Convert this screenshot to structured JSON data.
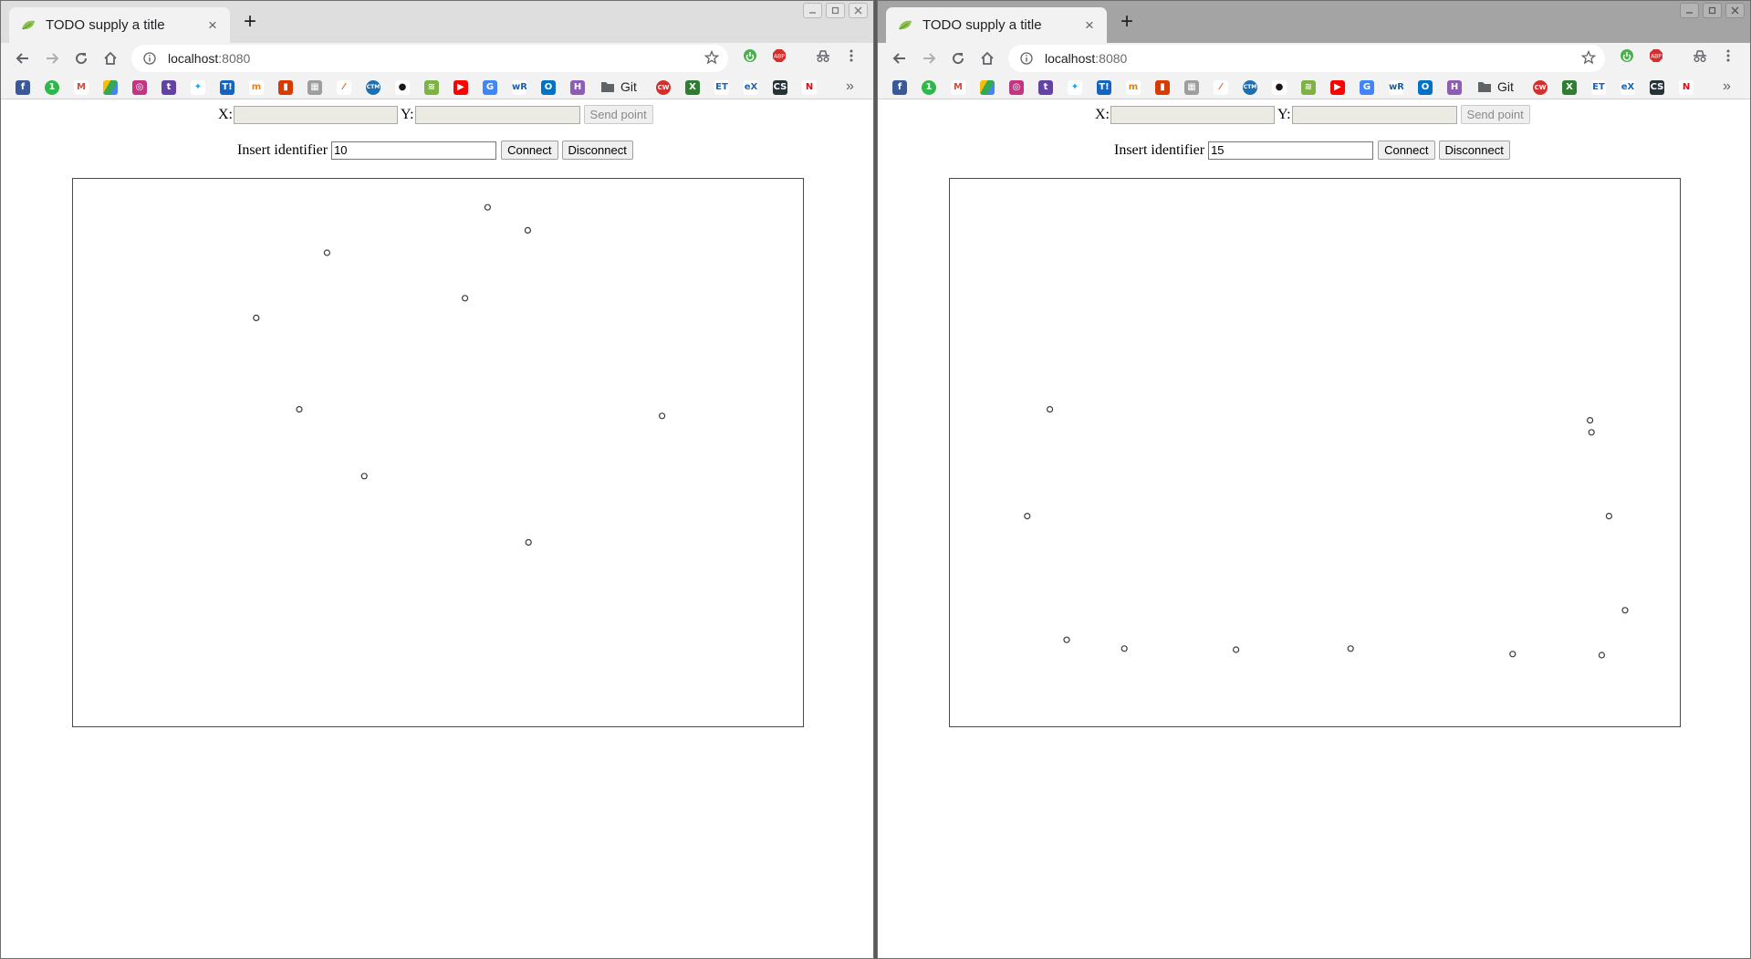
{
  "windows": [
    {
      "tab": {
        "title": "TODO supply a title"
      },
      "address": {
        "host": "localhost",
        "port": ":8080"
      },
      "bookmarks": {
        "folder_label": "Git"
      },
      "form": {
        "x_label": "X:",
        "y_label": "Y:",
        "send_label": "Send point",
        "identifier_label": "Insert identifier",
        "identifier_value": "10",
        "connect_label": "Connect",
        "disconnect_label": "Disconnect"
      },
      "points": [
        [
          0.568,
          0.052
        ],
        [
          0.623,
          0.094
        ],
        [
          0.348,
          0.135
        ],
        [
          0.537,
          0.218
        ],
        [
          0.251,
          0.254
        ],
        [
          0.31,
          0.421
        ],
        [
          0.807,
          0.433
        ],
        [
          0.399,
          0.543
        ],
        [
          0.624,
          0.664
        ]
      ]
    },
    {
      "tab": {
        "title": "TODO supply a title"
      },
      "address": {
        "host": "localhost",
        "port": ":8080"
      },
      "bookmarks": {
        "folder_label": "Git"
      },
      "form": {
        "x_label": "X:",
        "y_label": "Y:",
        "send_label": "Send point",
        "identifier_label": "Insert identifier",
        "identifier_value": "15",
        "connect_label": "Connect",
        "disconnect_label": "Disconnect"
      },
      "points": [
        [
          0.137,
          0.421
        ],
        [
          0.877,
          0.441
        ],
        [
          0.879,
          0.463
        ],
        [
          0.106,
          0.616
        ],
        [
          0.903,
          0.616
        ],
        [
          0.925,
          0.788
        ],
        [
          0.16,
          0.842
        ],
        [
          0.239,
          0.858
        ],
        [
          0.392,
          0.86
        ],
        [
          0.549,
          0.858
        ],
        [
          0.771,
          0.868
        ],
        [
          0.893,
          0.87
        ]
      ]
    }
  ]
}
